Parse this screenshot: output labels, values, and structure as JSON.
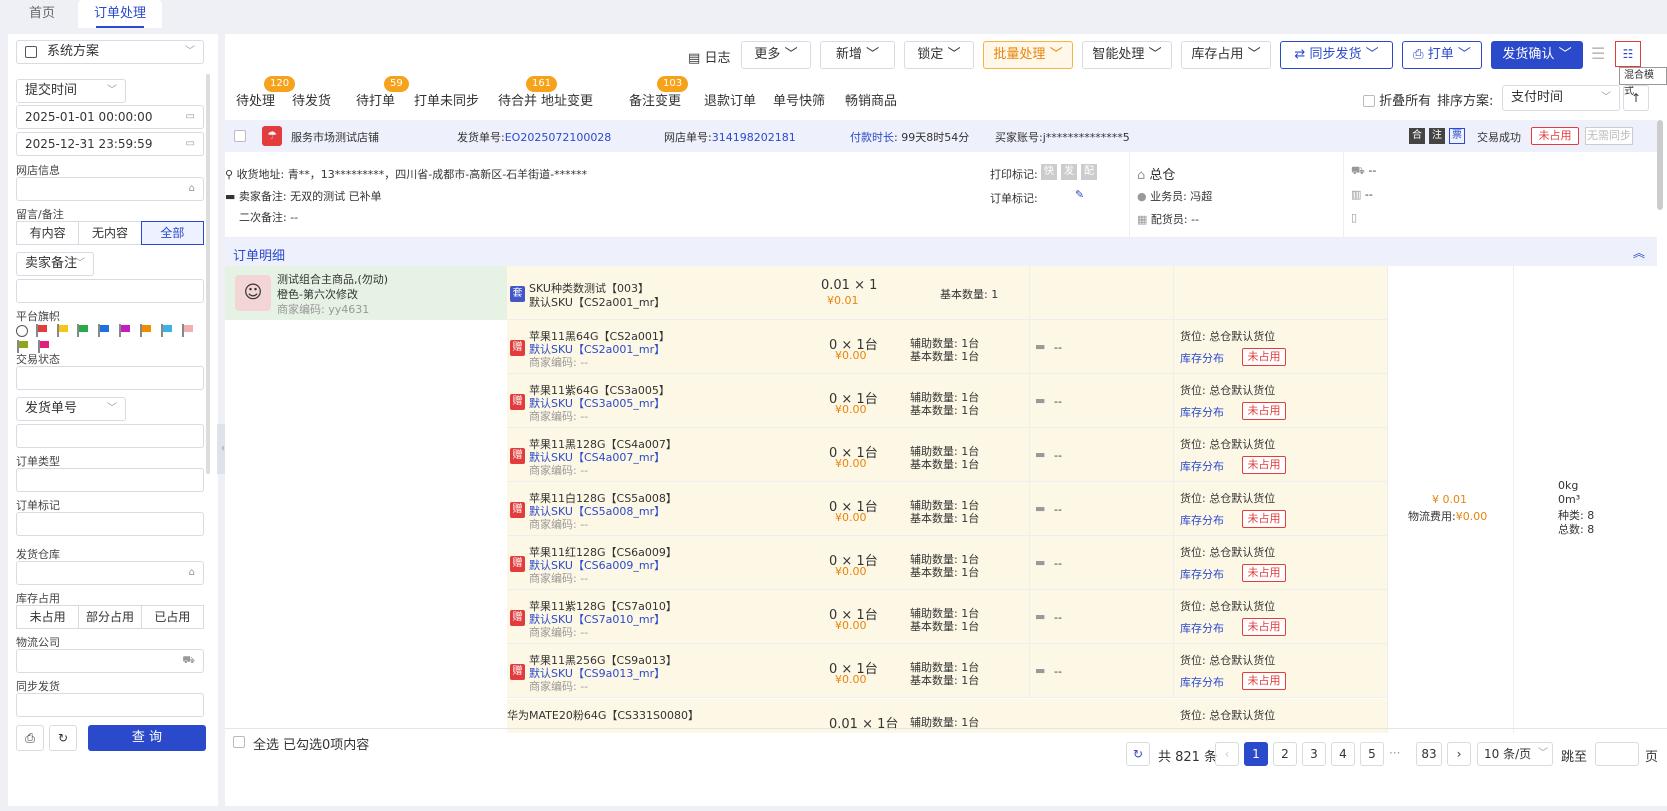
{
  "tabs": [
    "首页",
    "订单处理"
  ],
  "left": {
    "scheme": "系统方案",
    "time_field": "提交时间",
    "start": "2025-01-01 00:00:00",
    "end": "2025-12-31 23:59:59",
    "shop_label": "网店信息",
    "msg_label": "留言/备注",
    "msg_opts": [
      "有内容",
      "无内容",
      "全部"
    ],
    "seller_note": "卖家备注",
    "flag_label": "平台旗帜",
    "trade_status": "交易状态",
    "ship_no": "发货单号",
    "order_type": "订单类型",
    "order_mark": "订单标记",
    "warehouse": "发货仓库",
    "stock_label": "库存占用",
    "stock_opts": [
      "未占用",
      "部分占用",
      "已占用"
    ],
    "logistics": "物流公司",
    "sync": "同步发货",
    "query": "查 询"
  },
  "toolbar": {
    "log": "日志",
    "more": "更多",
    "add": "新增",
    "lock": "锁定",
    "batch": "批量处理",
    "smart": "智能处理",
    "stock": "库存占用",
    "sync": "同步发货",
    "print": "打单",
    "confirm": "发货确认",
    "tooltip": "混合模式"
  },
  "status_tabs": [
    {
      "label": "待处理",
      "badge": "120"
    },
    {
      "label": "待发货",
      "badge": ""
    },
    {
      "label": "待打单",
      "badge": "59"
    },
    {
      "label": "打单未同步",
      "badge": ""
    },
    {
      "label": "待合并",
      "badge": "161"
    },
    {
      "label": "地址变更",
      "badge": ""
    },
    {
      "label": "备注变更",
      "badge": "103"
    },
    {
      "label": "退款订单",
      "badge": ""
    },
    {
      "label": "单号快筛",
      "badge": ""
    },
    {
      "label": "畅销商品",
      "badge": ""
    }
  ],
  "fold_all": "折叠所有",
  "sort_label": "排序方案:",
  "sort_value": "支付时间",
  "order": {
    "shop": "服务市场测试店铺",
    "ship_label": "发货单号:",
    "ship_no": "EO2025072100028",
    "online_label": "网店单号:",
    "online_no": "314198202181",
    "pay_label": "付款时长",
    "pay_value": ": 99天8时54分",
    "buyer_label": "买家账号:",
    "buyer": "j**************5",
    "tags": [
      "合",
      "注",
      "票"
    ],
    "trade": "交易成功",
    "unocc": "未占用",
    "nosync": "无需同步",
    "address": "收货地址:  青**，13*********，四川省-成都市-高新区-石羊街道-******",
    "seller_note": "卖家备注:  无双的测试  已补单",
    "second_note": "二次备注:  --",
    "print_mark": "打印标记:",
    "print_tags": [
      "快",
      "发",
      "配"
    ],
    "order_mark": "订单标记:",
    "warehouse": "总仓",
    "salesman": "业务员: 冯超",
    "picker": "配货员: --",
    "dash": "--",
    "detail_title": "订单明细"
  },
  "main_product": {
    "name": "测试组合主商品,(勿动)",
    "spec": "橙色-第六次修改",
    "code": "商家编码:  yy4631"
  },
  "combo": {
    "tag": "套",
    "name": "SKU种类数测试【003】",
    "sku": "默认SKU【CS2a001_mr】",
    "qty": "0.01 × 1",
    "price": "¥0.01",
    "base": "基本数量:  1"
  },
  "items": [
    {
      "name": "苹果11黑64G【CS2a001】",
      "sku": "默认SKU【CS2a001_mr】"
    },
    {
      "name": "苹果11紫64G【CS3a005】",
      "sku": "默认SKU【CS3a005_mr】"
    },
    {
      "name": "苹果11黑128G【CS4a007】",
      "sku": "默认SKU【CS4a007_mr】"
    },
    {
      "name": "苹果11白128G【CS5a008】",
      "sku": "默认SKU【CS5a008_mr】"
    },
    {
      "name": "苹果11红128G【CS6a009】",
      "sku": "默认SKU【CS6a009_mr】"
    },
    {
      "name": "苹果11紫128G【CS7a010】",
      "sku": "默认SKU【CS7a010_mr】"
    },
    {
      "name": "苹果11黑256G【CS9a013】",
      "sku": "默认SKU【CS9a013_mr】"
    }
  ],
  "item_common": {
    "gift": "赠",
    "code": "商家编码:  --",
    "qty": "0 × 1台",
    "price": "¥0.00",
    "aux": "辅助数量: 1台",
    "base": "基本数量: 1台",
    "note": "--",
    "loc": "货位:  总仓默认货位",
    "dist": "库存分布",
    "unocc": "未占用"
  },
  "last_item": {
    "name": "华为MATE20粉64G【CS331S0080】",
    "qty": "0.01 × 1台",
    "aux": "辅助数量: 1台",
    "loc": "货位:  总仓默认货位"
  },
  "summary": {
    "amount": "¥ 0.01",
    "freight_label": "物流费用:",
    "freight": "¥0.00",
    "weight": "0kg",
    "volume": "0m³",
    "kinds": "种类:  8",
    "total": "总数:  8"
  },
  "footer": {
    "select_all": "全选",
    "selected": "已勾选0项内容",
    "total": "共 821 条",
    "pages": [
      "1",
      "2",
      "3",
      "4",
      "5"
    ],
    "ellipsis": "···",
    "last": "83",
    "per_page": "10 条/页",
    "jump": "跳至",
    "page_unit": "页"
  },
  "colors": {
    "primary": "#2b4acb",
    "orange": "#f7a21b",
    "red": "#e23c3c"
  }
}
